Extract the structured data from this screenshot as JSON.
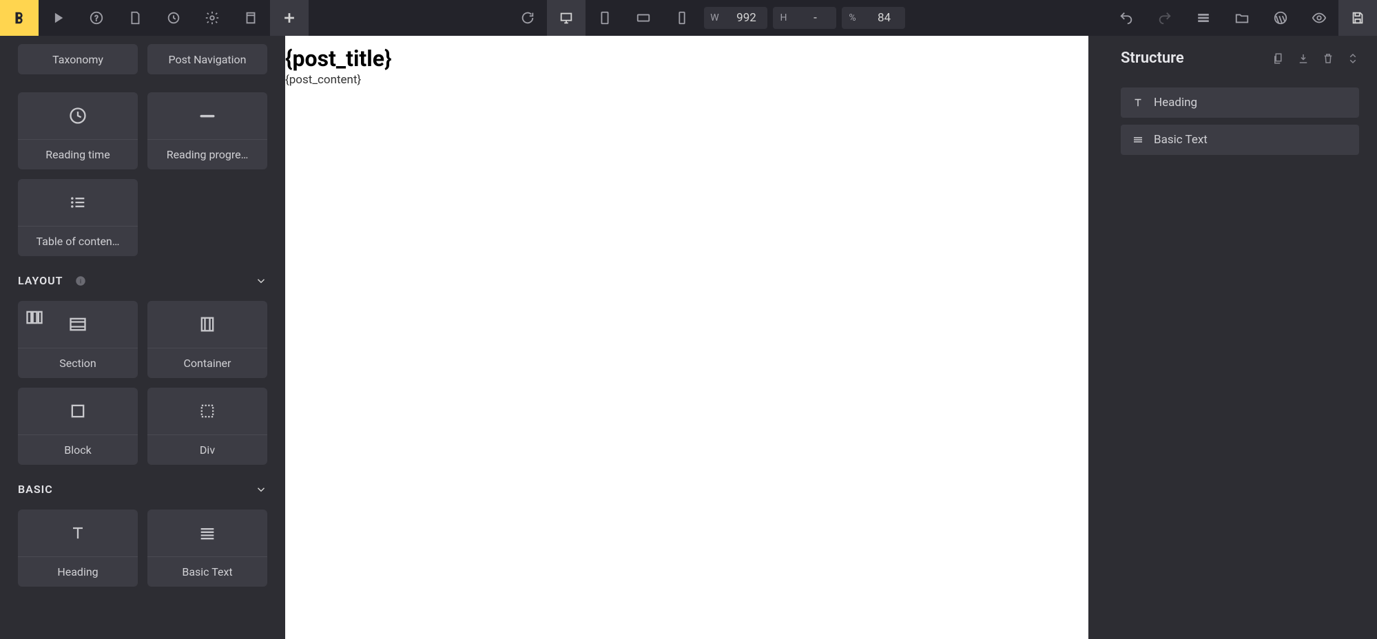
{
  "toolbar": {
    "width": {
      "label": "W",
      "value": "992"
    },
    "height": {
      "label": "H",
      "value": "-"
    },
    "zoom": {
      "label": "%",
      "value": "84"
    }
  },
  "left": {
    "items_top": [
      {
        "label": "Taxonomy"
      },
      {
        "label": "Post Navigation"
      }
    ],
    "items_mid": [
      {
        "label": "Reading time",
        "icon": "clock"
      },
      {
        "label": "Reading progre…",
        "icon": "progress"
      },
      {
        "label": "Table of conten…",
        "icon": "toc"
      }
    ],
    "layout_title": "LAYOUT",
    "layout_items": [
      {
        "label": "Section",
        "icon": "section",
        "badge": true
      },
      {
        "label": "Container",
        "icon": "container"
      },
      {
        "label": "Block",
        "icon": "block"
      },
      {
        "label": "Div",
        "icon": "div"
      }
    ],
    "basic_title": "BASIC",
    "basic_items": [
      {
        "label": "Heading",
        "icon": "heading"
      },
      {
        "label": "Basic Text",
        "icon": "text"
      }
    ]
  },
  "canvas": {
    "title": "{post_title}",
    "content": "{post_content}"
  },
  "right": {
    "title": "Structure",
    "items": [
      {
        "label": "Heading",
        "icon": "heading"
      },
      {
        "label": "Basic Text",
        "icon": "text"
      }
    ]
  }
}
